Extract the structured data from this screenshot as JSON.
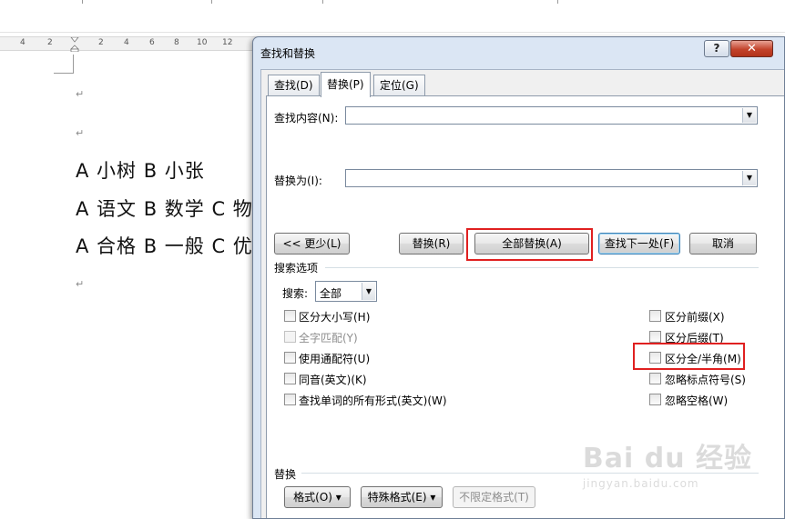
{
  "document": {
    "ruler_numbers": [
      "4",
      "2",
      "2",
      "4",
      "6",
      "8",
      "10",
      "12"
    ],
    "lines": [
      "A 小树     B 小张",
      "A 语文  B 数学  C  物",
      "A 合格 B 一般 C 优"
    ],
    "paragraph_mark": "↵"
  },
  "dialog": {
    "title": "查找和替换",
    "help_label": "?",
    "close_label": "✕",
    "tabs": [
      "查找(D)",
      "替换(P)",
      "定位(G)"
    ],
    "find_label": "查找内容(N):",
    "find_value": "",
    "replace_label": "替换为(I):",
    "replace_value": "",
    "buttons": {
      "less": "<< 更少(L)",
      "replace": "替换(R)",
      "replace_all": "全部替换(A)",
      "find_next": "查找下一处(F)",
      "cancel": "取消"
    },
    "search_options_title": "搜索选项",
    "search_label": "搜索:",
    "search_value": "全部",
    "left_options": [
      {
        "label": "区分大小写(H)",
        "checked": false,
        "enabled": true
      },
      {
        "label": "全字匹配(Y)",
        "checked": false,
        "enabled": false
      },
      {
        "label": "使用通配符(U)",
        "checked": false,
        "enabled": true
      },
      {
        "label": "同音(英文)(K)",
        "checked": false,
        "enabled": true
      },
      {
        "label": "查找单词的所有形式(英文)(W)",
        "checked": false,
        "enabled": true
      }
    ],
    "right_options": [
      {
        "label": "区分前缀(X)",
        "checked": false
      },
      {
        "label": "区分后缀(T)",
        "checked": false
      },
      {
        "label": "区分全/半角(M)",
        "checked": false
      },
      {
        "label": "忽略标点符号(S)",
        "checked": false
      },
      {
        "label": "忽略空格(W)",
        "checked": false
      }
    ],
    "replace_section_title": "替换",
    "format_buttons": {
      "format": "格式(O) ▾",
      "special": "特殊格式(E) ▾",
      "no_format": "不限定格式(T)"
    }
  },
  "watermark": {
    "brand": "Bai du 经验",
    "url": "jingyan.baidu.com"
  },
  "colors": {
    "highlight_box": "#e02020",
    "close_button": "#c2432b",
    "dialog_frame": "#dbe6f4"
  }
}
